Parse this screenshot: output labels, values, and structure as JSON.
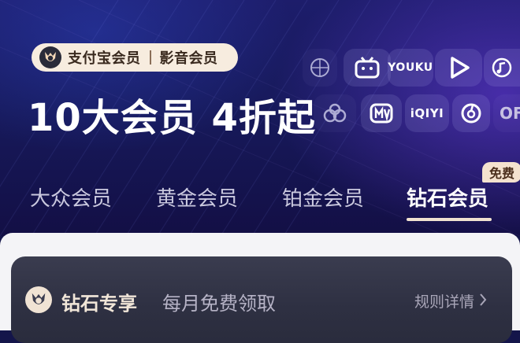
{
  "banner": {
    "brand_left": "支付宝会员",
    "brand_right": "影音会员",
    "headline": "10大会员 4折起"
  },
  "partner_icons": [
    {
      "name": "basketball-icon",
      "text": ""
    },
    {
      "name": "bilibili-tv-icon",
      "text": ""
    },
    {
      "name": "youku-logo-icon",
      "text": "YOUKU"
    },
    {
      "name": "play-triangle-icon",
      "text": ""
    },
    {
      "name": "music-note-icon",
      "text": ""
    },
    {
      "name": "cloud-icon",
      "text": ""
    },
    {
      "name": "mango-tv-icon",
      "text": ""
    },
    {
      "name": "iqiyi-logo-icon",
      "text": "iQIYI"
    },
    {
      "name": "netease-music-icon",
      "text": ""
    },
    {
      "name": "partial-logo-icon",
      "text": "OF"
    }
  ],
  "tabs": [
    {
      "label": "大众会员",
      "active": false
    },
    {
      "label": "黄金会员",
      "active": false
    },
    {
      "label": "铂金会员",
      "active": false
    },
    {
      "label": "钻石会员",
      "active": true
    }
  ],
  "free_badge": "免费",
  "card": {
    "title": "钻石专享",
    "subtitle": "每月免费领取",
    "rules_link": "规则详情",
    "chevron_icon": "chevron-right-icon"
  },
  "colors": {
    "hero_dark": "#14154a",
    "accent_gold": "#f4e2cf",
    "card_bg": "#2e3042"
  }
}
